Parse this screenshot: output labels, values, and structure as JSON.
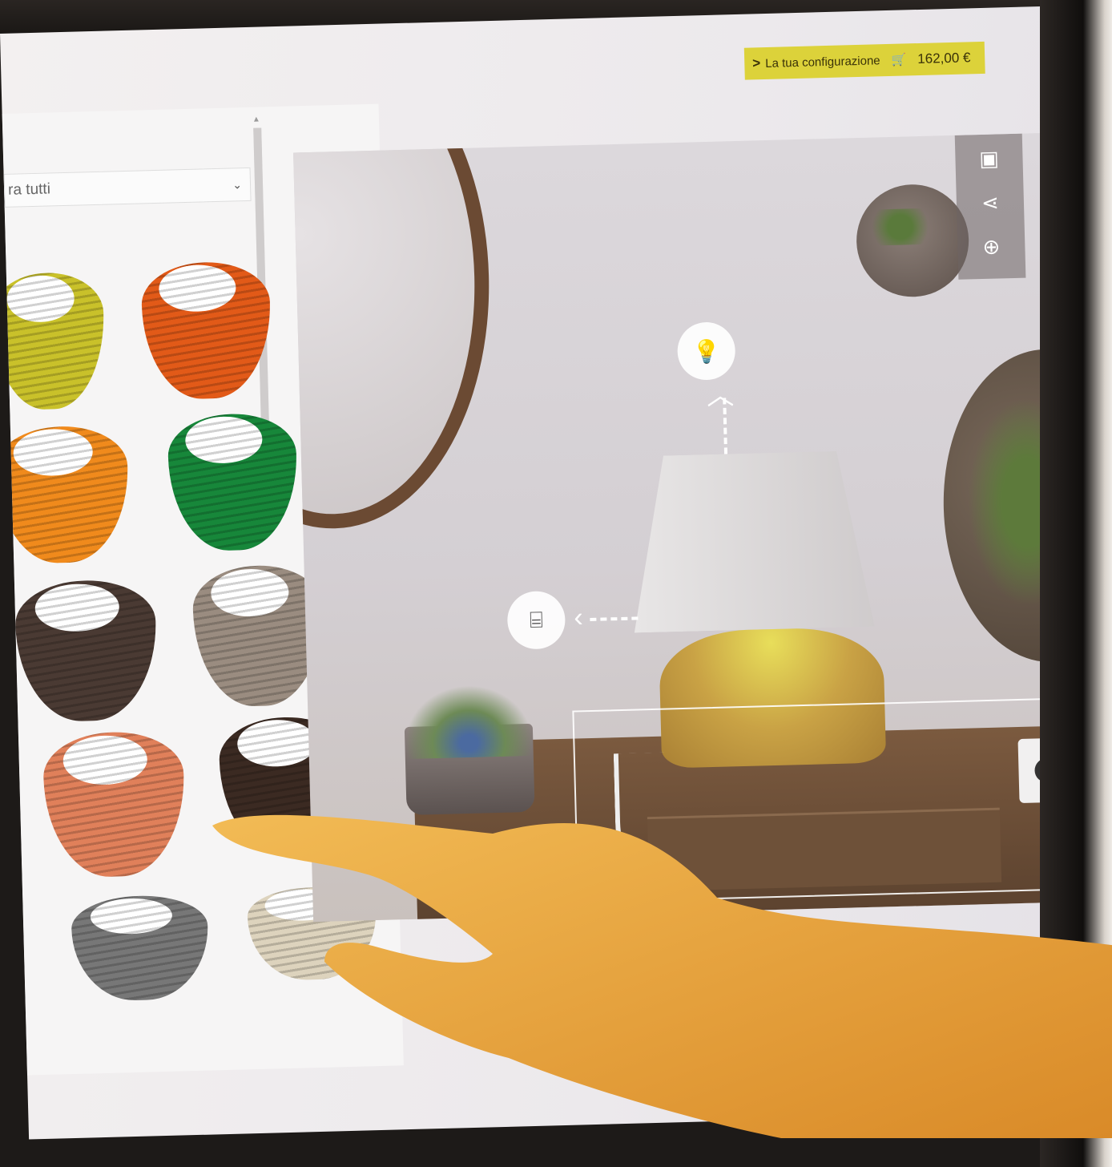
{
  "header": {
    "config_label": "La tua configurazione",
    "price": "162,00 €",
    "accent_color": "#dcd23a"
  },
  "filter": {
    "value_visible": "ra tutti"
  },
  "swatches": [
    {
      "name": "yellow-green",
      "color": "#c9c12a"
    },
    {
      "name": "orange-red",
      "color": "#e25a18"
    },
    {
      "name": "orange",
      "color": "#f08a1c"
    },
    {
      "name": "green",
      "color": "#17873a"
    },
    {
      "name": "dark-brown",
      "color": "#4a3a33"
    },
    {
      "name": "taupe",
      "color": "#9a8c80"
    },
    {
      "name": "salmon",
      "color": "#e0805a"
    },
    {
      "name": "dark-mocha",
      "color": "#3b2a22"
    },
    {
      "name": "black-white-houndstooth",
      "color": "#777777"
    },
    {
      "name": "cream",
      "color": "#ddd3bd"
    }
  ],
  "tools": [
    {
      "name": "image-icon",
      "glyph": "▣"
    },
    {
      "name": "share-icon",
      "glyph": "⋖"
    },
    {
      "name": "zoom-in-icon",
      "glyph": "⊕"
    }
  ],
  "hotspots": [
    {
      "name": "bulb-hotspot-icon",
      "glyph": "💡"
    },
    {
      "name": "shade-hotspot-icon",
      "glyph": "⌸"
    }
  ]
}
